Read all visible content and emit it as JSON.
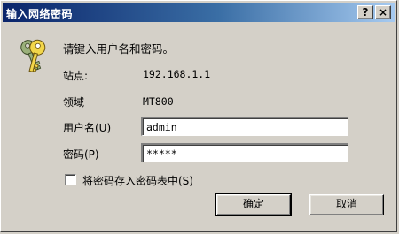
{
  "window": {
    "title": "输入网络密码",
    "help_label": "?",
    "close_label": "×"
  },
  "prompt": "请键入用户名和密码。",
  "site": {
    "label": "站点:",
    "value": "192.168.1.1"
  },
  "realm": {
    "label": "领域",
    "value": "MT800"
  },
  "username": {
    "label": "用户名(U)",
    "value": "admin"
  },
  "password": {
    "label": "密码(P)",
    "value": "*****"
  },
  "remember": {
    "label": "将密码存入密码表中(S)",
    "checked": false
  },
  "buttons": {
    "ok": "确定",
    "cancel": "取消"
  },
  "icon": "keys-icon",
  "colors": {
    "titlebar_start": "#0a246a",
    "titlebar_end": "#a6caf0",
    "face": "#d4d0c8"
  }
}
